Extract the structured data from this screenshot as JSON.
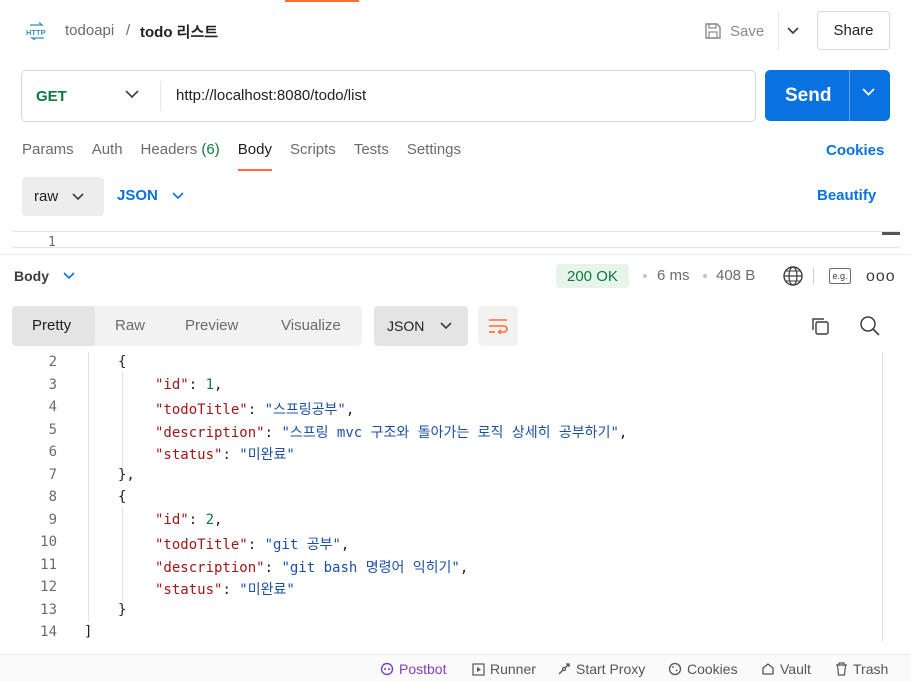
{
  "header": {
    "icon": "http-request-icon",
    "breadcrumb_parent": "todoapi",
    "breadcrumb_sep": "/",
    "request_title": "todo 리스트",
    "save_label": "Save",
    "share_label": "Share"
  },
  "request": {
    "method": "GET",
    "url": "http://localhost:8080/todo/list",
    "send_label": "Send",
    "tabs": [
      {
        "label": "Params"
      },
      {
        "label": "Auth"
      },
      {
        "label": "Headers",
        "count": "(6)"
      },
      {
        "label": "Body",
        "active": true
      },
      {
        "label": "Scripts"
      },
      {
        "label": "Tests"
      },
      {
        "label": "Settings"
      }
    ],
    "cookies_label": "Cookies",
    "body_type": "raw",
    "body_format": "JSON",
    "beautify_label": "Beautify",
    "editor_first_line": "1"
  },
  "response": {
    "section_label": "Body",
    "status": "200 OK",
    "time": "6 ms",
    "size": "408 B",
    "eg_label": "e.g.",
    "more_label": "ooo",
    "view_tabs": [
      "Pretty",
      "Raw",
      "Preview",
      "Visualize"
    ],
    "active_view": "Pretty",
    "format": "JSON",
    "code_lines": [
      {
        "n": "2",
        "indent": 1,
        "text": "{"
      },
      {
        "n": "3",
        "indent": 2,
        "key": "\"id\"",
        "value": "1",
        "type": "num",
        "comma": ","
      },
      {
        "n": "4",
        "indent": 2,
        "key": "\"todoTitle\"",
        "value": "\"스프링공부\"",
        "type": "str",
        "comma": ","
      },
      {
        "n": "5",
        "indent": 2,
        "key": "\"description\"",
        "value": "\"스프링 mvc 구조와 돌아가는 로직 상세히 공부하기\"",
        "type": "str",
        "comma": ","
      },
      {
        "n": "6",
        "indent": 2,
        "key": "\"status\"",
        "value": "\"미완료\"",
        "type": "str",
        "comma": ""
      },
      {
        "n": "7",
        "indent": 1,
        "text": "},"
      },
      {
        "n": "8",
        "indent": 1,
        "text": "{"
      },
      {
        "n": "9",
        "indent": 2,
        "key": "\"id\"",
        "value": "2",
        "type": "num",
        "comma": ","
      },
      {
        "n": "10",
        "indent": 2,
        "key": "\"todoTitle\"",
        "value": "\"git 공부\"",
        "type": "str",
        "comma": ","
      },
      {
        "n": "11",
        "indent": 2,
        "key": "\"description\"",
        "value": "\"git bash 명령어 익히기\"",
        "type": "str",
        "comma": ","
      },
      {
        "n": "12",
        "indent": 2,
        "key": "\"status\"",
        "value": "\"미완료\"",
        "type": "str",
        "comma": ""
      },
      {
        "n": "13",
        "indent": 1,
        "text": "}"
      },
      {
        "n": "14",
        "indent": 0,
        "text": "]"
      }
    ]
  },
  "status_bar": [
    {
      "label": "Postbot",
      "icon": "postbot-icon"
    },
    {
      "label": "Runner",
      "icon": "runner-icon"
    },
    {
      "label": "Start Proxy",
      "icon": "proxy-icon"
    },
    {
      "label": "Cookies",
      "icon": "cookie-icon"
    },
    {
      "label": "Vault",
      "icon": "vault-icon"
    },
    {
      "label": "Trash",
      "icon": "trash-icon"
    }
  ],
  "colors": {
    "accent": "#ff6c37",
    "send_blue": "#0a72e0",
    "method_green": "#0b7a3e",
    "json_key": "#a31515",
    "json_string": "#1c4fa8",
    "json_number": "#0b7a3e"
  }
}
